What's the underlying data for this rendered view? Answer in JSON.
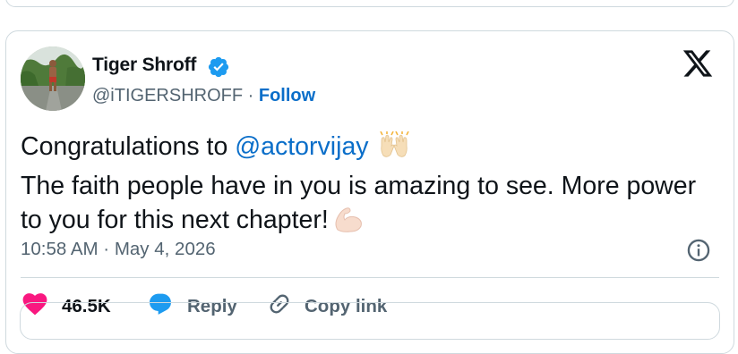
{
  "author": {
    "name": "Tiger Shroff",
    "handle": "@iTIGERSHROFF",
    "separator": "·",
    "follow_label": "Follow",
    "verified": true
  },
  "tweet": {
    "line1_prefix": "Congratulations to ",
    "mention": "@actorvijay",
    "line2": "The faith people have in you is amazing to see. More power to you for this next chapter!",
    "emoji_1": "raising-hands",
    "emoji_2": "flexed-biceps"
  },
  "timestamp": "10:58 AM · May 4, 2026",
  "actions": {
    "like_count": "46.5K",
    "reply_label": "Reply",
    "copy_link_label": "Copy link"
  },
  "colors": {
    "link": "#0a6ec9",
    "like": "#f91880",
    "reply": "#1d9bf0",
    "muted": "#536471",
    "border": "#cfd9de"
  },
  "icons": [
    "verified-badge-icon",
    "x-logo-icon",
    "info-icon",
    "heart-icon",
    "reply-bubble-icon",
    "link-icon"
  ]
}
